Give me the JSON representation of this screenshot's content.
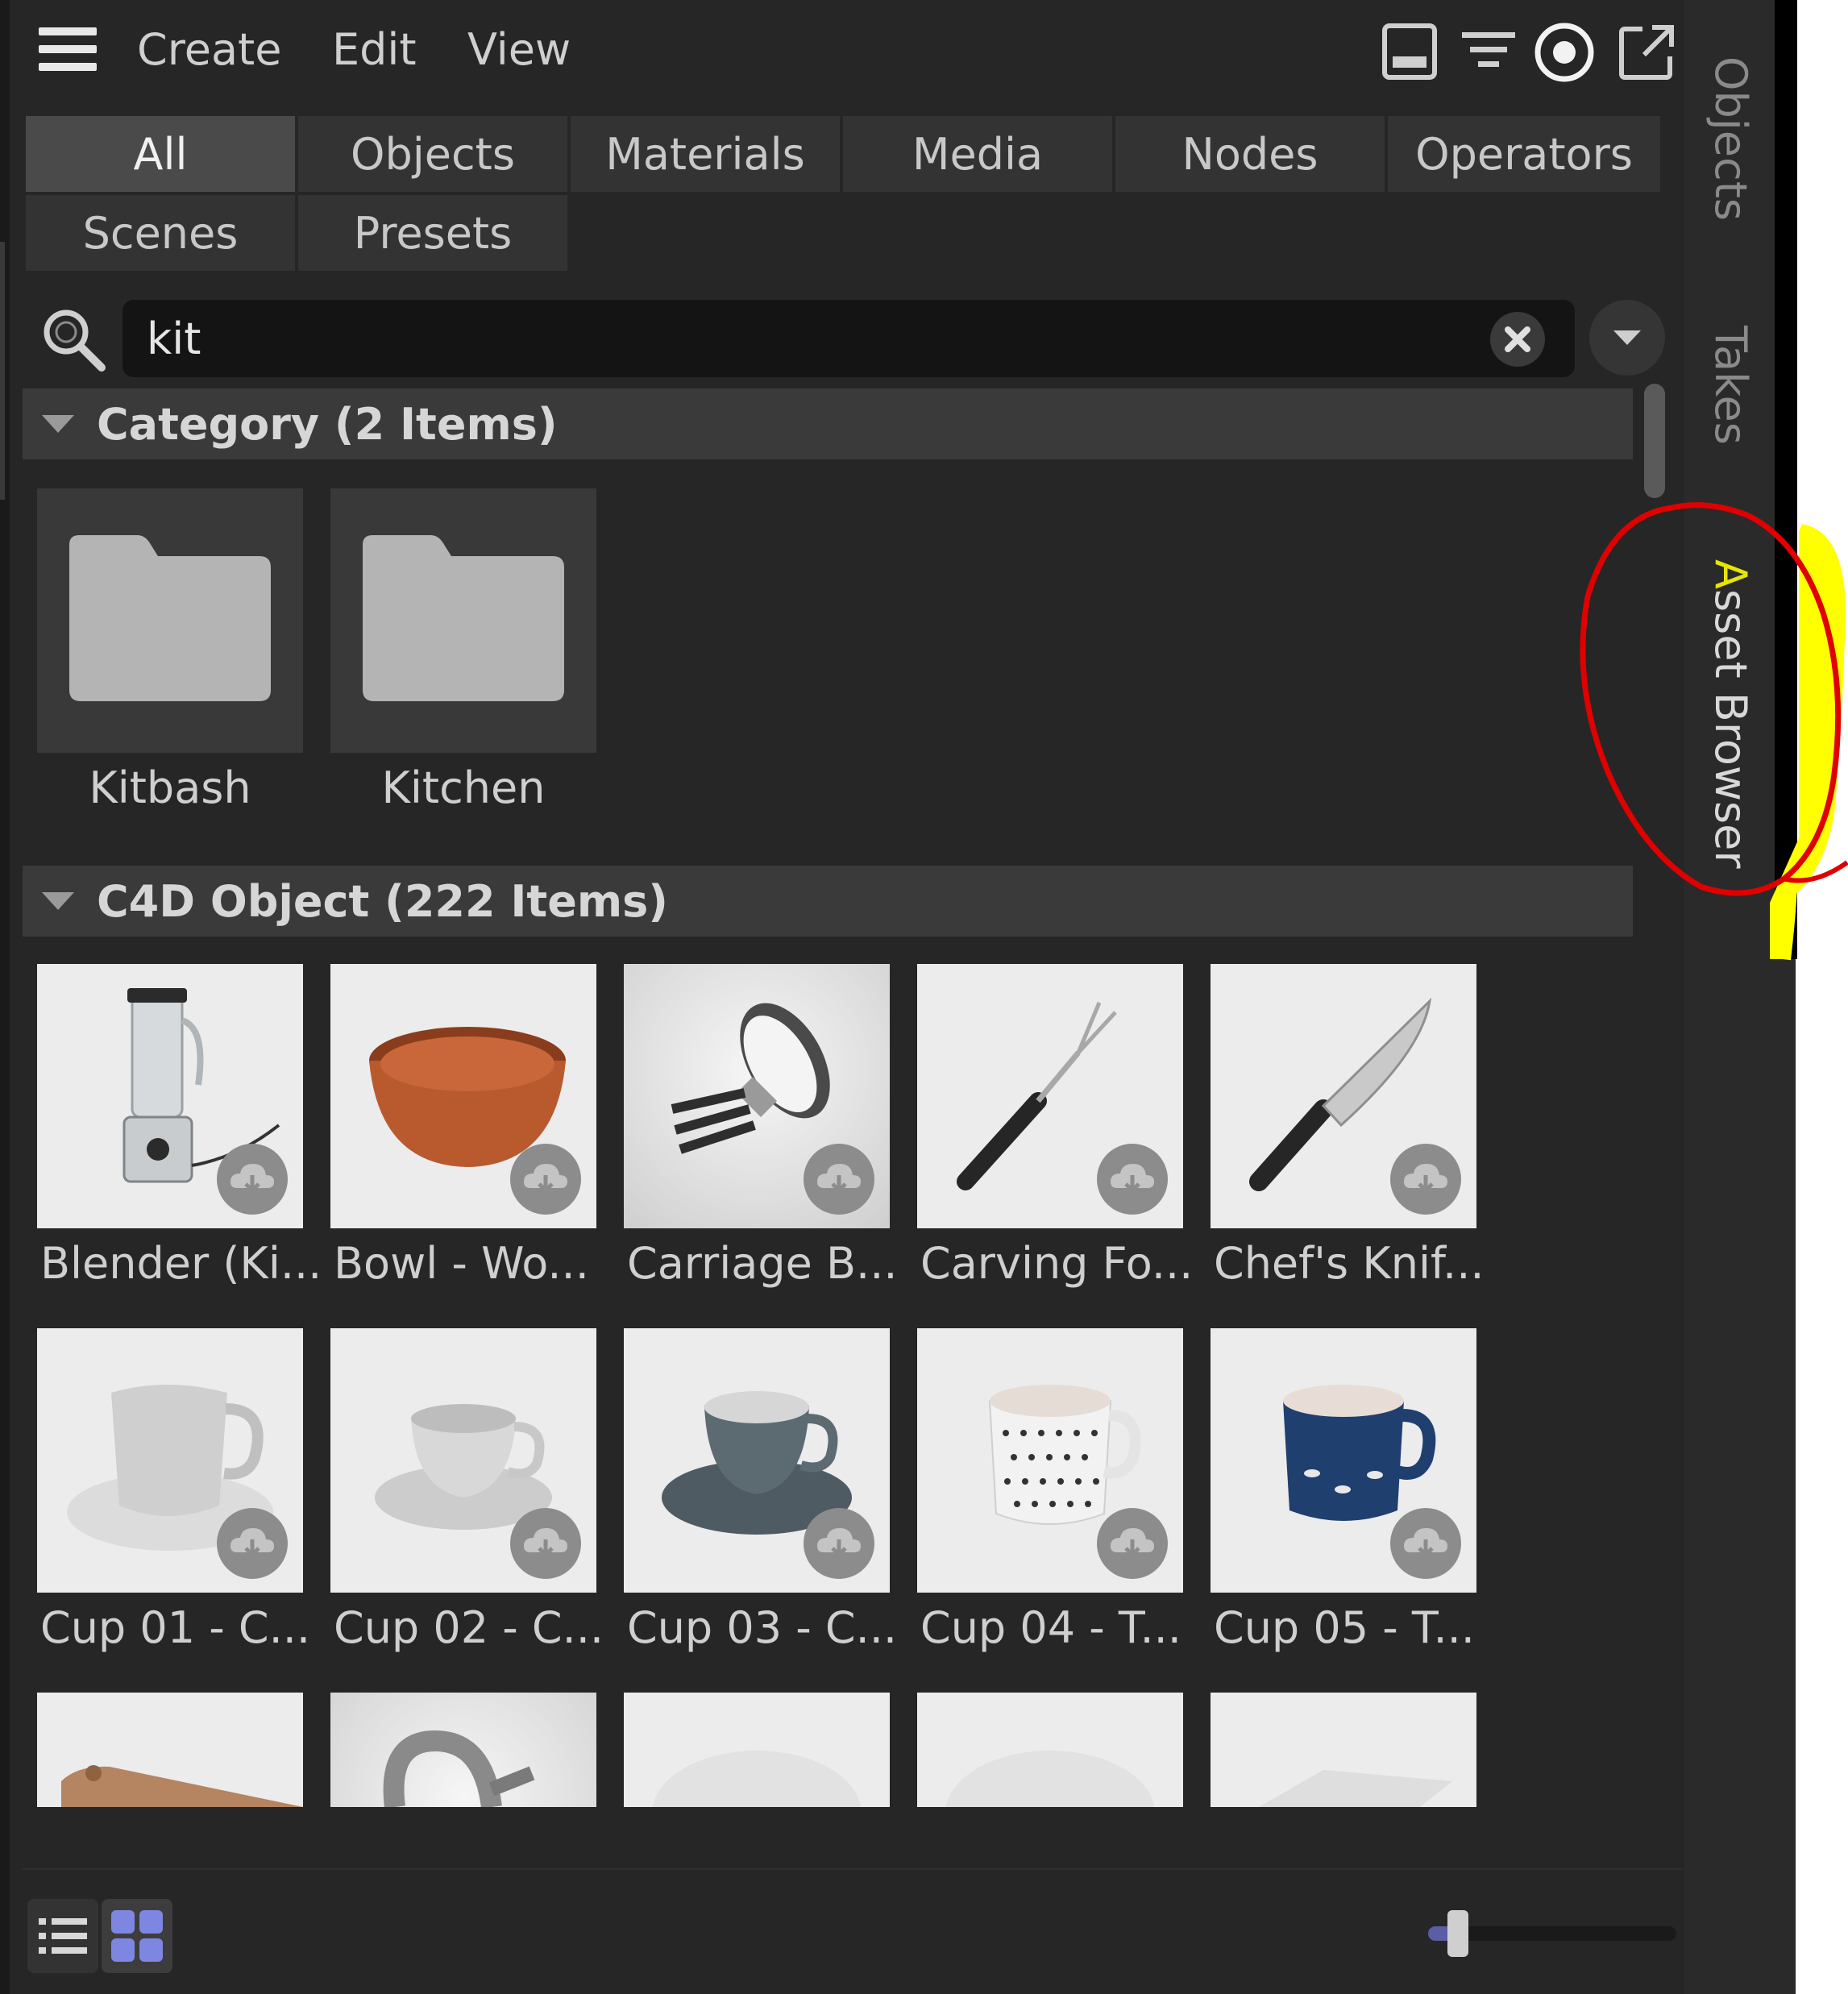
{
  "menu": {
    "items": [
      "Create",
      "Edit",
      "View"
    ]
  },
  "tabs": [
    "All",
    "Objects",
    "Materials",
    "Media",
    "Nodes",
    "Operators",
    "Scenes",
    "Presets"
  ],
  "active_tab": "All",
  "search": {
    "value": "kit"
  },
  "sections": {
    "category": {
      "title": "Category (2 Items)",
      "items": [
        "Kitbash",
        "Kitchen"
      ]
    },
    "objects": {
      "title": "C4D Object (222 Items)",
      "items": [
        "Blender (Ki...",
        "Bowl - Wo...",
        "Carriage B...",
        "Carving Fo...",
        "Chef's Knif...",
        "Cup 01 - C...",
        "Cup 02 - C...",
        "Cup 03 - C...",
        "Cup 04 - T...",
        "Cup 05 - T..."
      ]
    }
  },
  "side_tabs": [
    "Objects",
    "Takes",
    "Asset Browser"
  ],
  "active_side_tab": "Asset Browser",
  "zoom_slider": {
    "value": 0.12
  },
  "colors": {
    "panel": "#262626",
    "accent": "#5a5fa5",
    "annotation_red": "#e00000",
    "annotation_yellow": "#ffff00"
  }
}
